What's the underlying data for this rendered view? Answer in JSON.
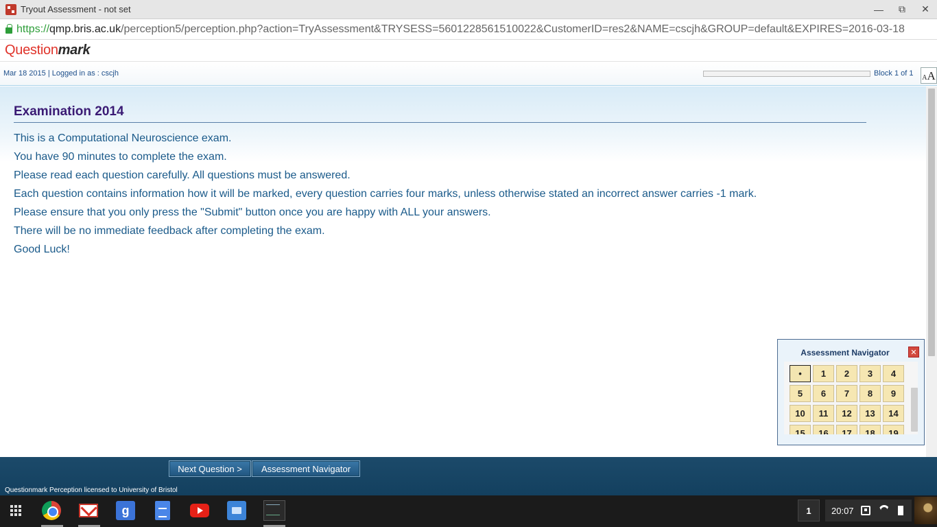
{
  "window": {
    "title": "Tryout Assessment - not set",
    "controls": {
      "minimize": "—",
      "restore": "⧉",
      "close": "✕"
    }
  },
  "address_bar": {
    "scheme": "https://",
    "host": "qmp.bris.ac.uk",
    "path": "/perception5/perception.php?action=TryAssessment&TRYSESS=5601228561510022&CustomerID=res2&NAME=cscjh&GROUP=default&EXPIRES=2016-03-18"
  },
  "logo": {
    "part1": "Question",
    "part2": "mark"
  },
  "info": {
    "session": "Mar 18 2015 |  Logged in as : cscjh",
    "block": "Block 1 of 1",
    "progress": 0,
    "font_small": "A",
    "font_big": "A"
  },
  "exam": {
    "title": "Examination 2014",
    "lines": [
      "This is a Computational Neuroscience exam.",
      "You have 90 minutes to complete the exam.",
      "Please read each question carefully. All questions must be answered.",
      "Each question contains information how it will be marked, every question carries four marks, unless otherwise stated an incorrect answer carries -1 mark.",
      "Please ensure that you only press the \"Submit\" button once you are happy with ALL your answers.",
      "There will be no immediate feedback after completing the exam.",
      "Good Luck!"
    ]
  },
  "navigator": {
    "title": "Assessment Navigator",
    "close": "✕",
    "cells": [
      "•",
      "1",
      "2",
      "3",
      "4",
      "5",
      "6",
      "7",
      "8",
      "9",
      "10",
      "11",
      "12",
      "13",
      "14",
      "15",
      "16",
      "17",
      "18",
      "19"
    ]
  },
  "footer": {
    "next_button": "Next Question >",
    "navigator_button": "Assessment Navigator",
    "license": "Questionmark Perception licensed to University of Bristol"
  },
  "taskbar": {
    "google_letter": "g",
    "workspace": "1",
    "clock": "20:07"
  },
  "colors": {
    "title_purple": "#3a1a74",
    "text_blue": "#1a5a8a",
    "footer_blue": "#1c4a6a",
    "nav_cell": "#f6e7b2",
    "logo_red": "#e0342b"
  }
}
